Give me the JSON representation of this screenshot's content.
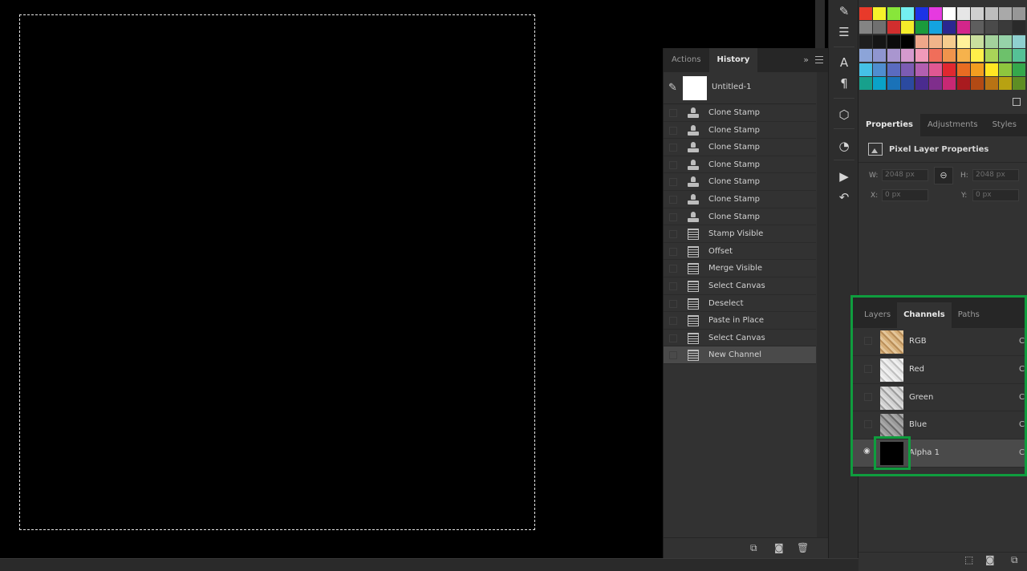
{
  "history_panel": {
    "tabs": [
      {
        "label": "Actions",
        "active": false
      },
      {
        "label": "History",
        "active": true
      }
    ],
    "snapshot": {
      "label": "Untitled-1"
    },
    "items": [
      {
        "label": "Clone Stamp",
        "icon": "clone-stamp-icon",
        "selected": false
      },
      {
        "label": "Clone Stamp",
        "icon": "clone-stamp-icon",
        "selected": false
      },
      {
        "label": "Clone Stamp",
        "icon": "clone-stamp-icon",
        "selected": false
      },
      {
        "label": "Clone Stamp",
        "icon": "clone-stamp-icon",
        "selected": false
      },
      {
        "label": "Clone Stamp",
        "icon": "clone-stamp-icon",
        "selected": false
      },
      {
        "label": "Clone Stamp",
        "icon": "clone-stamp-icon",
        "selected": false
      },
      {
        "label": "Clone Stamp",
        "icon": "clone-stamp-icon",
        "selected": false
      },
      {
        "label": "Stamp Visible",
        "icon": "document-icon",
        "selected": false
      },
      {
        "label": "Offset",
        "icon": "document-icon",
        "selected": false
      },
      {
        "label": "Merge Visible",
        "icon": "document-icon",
        "selected": false
      },
      {
        "label": "Select Canvas",
        "icon": "document-icon",
        "selected": false
      },
      {
        "label": "Deselect",
        "icon": "document-icon",
        "selected": false
      },
      {
        "label": "Paste in Place",
        "icon": "document-icon",
        "selected": false
      },
      {
        "label": "Select Canvas",
        "icon": "document-icon",
        "selected": false
      },
      {
        "label": "New Channel",
        "icon": "document-icon",
        "selected": true
      }
    ]
  },
  "tools": [
    "brush-settings-icon",
    "adjust-sliders-icon",
    "character-icon",
    "paragraph-icon",
    "3d-cube-icon",
    "alien-head-icon",
    "play-icon",
    "history-brush-icon"
  ],
  "swatches": {
    "colors": [
      [
        "#e83a2a",
        "#f6f22a",
        "#88e63a",
        "#74f0f0",
        "#1c33e6",
        "#e63ae0",
        "#ffffff",
        "#e6e6e6",
        "#cfcfcf",
        "#bdbdbd",
        "#a9a9a9",
        "#979797"
      ],
      [
        "#848484",
        "#707070",
        "#d12e2e",
        "#f4ec2a",
        "#1a9b3c",
        "#14a3e0",
        "#2a2790",
        "#d3268a",
        "#5e5e5e",
        "#4a4a4a",
        "#3a3a3a",
        "#2a2a2a"
      ],
      [
        "#1e1e1e",
        "#151515",
        "#0b0b0b",
        "#000000",
        "#efa78a",
        "#f0b48a",
        "#f6cc8e",
        "#fff19a",
        "#c9e09e",
        "#a4d29c",
        "#96d2a8",
        "#8fd0cf"
      ],
      [
        "#8ca4d8",
        "#8f96d0",
        "#a996cf",
        "#d59ace",
        "#f19ab9",
        "#f06e5a",
        "#f0944c",
        "#f6b24c",
        "#fff04a",
        "#a9d458",
        "#6dc16b",
        "#55c196"
      ],
      [
        "#45c1e6",
        "#4f8ed0",
        "#5a6bc0",
        "#7c5cb3",
        "#b25fb0",
        "#e05892",
        "#e02830",
        "#e86c22",
        "#f29e20",
        "#ffe623",
        "#8ec63e",
        "#35a84c"
      ],
      [
        "#17a08c",
        "#0aa2c8",
        "#1a72b8",
        "#2b4aa0",
        "#4a2b8f",
        "#7f2e8c",
        "#c82874",
        "#a91b1f",
        "#b34a14",
        "#b87314",
        "#b8a212",
        "#5e8e24"
      ]
    ]
  },
  "properties_panel": {
    "tabs": [
      {
        "label": "Properties",
        "active": true
      },
      {
        "label": "Adjustments",
        "active": false
      },
      {
        "label": "Styles",
        "active": false
      }
    ],
    "title": "Pixel Layer Properties",
    "w_label": "W:",
    "w_value": "2048 px",
    "h_label": "H:",
    "h_value": "2048 px",
    "x_label": "X:",
    "x_value": "0 px",
    "y_label": "Y:",
    "y_value": "0 px"
  },
  "channels_panel": {
    "tabs": [
      {
        "label": "Layers",
        "active": false
      },
      {
        "label": "Channels",
        "active": true
      },
      {
        "label": "Paths",
        "active": false
      }
    ],
    "channels": [
      {
        "name": "RGB",
        "shortcut": "C",
        "visible": false,
        "selected": false
      },
      {
        "name": "Red",
        "shortcut": "C",
        "visible": false,
        "selected": false
      },
      {
        "name": "Green",
        "shortcut": "C",
        "visible": false,
        "selected": false
      },
      {
        "name": "Blue",
        "shortcut": "C",
        "visible": false,
        "selected": false
      },
      {
        "name": "Alpha 1",
        "shortcut": "C",
        "visible": true,
        "selected": true
      }
    ],
    "highlight_color": "#0f9d3e"
  }
}
